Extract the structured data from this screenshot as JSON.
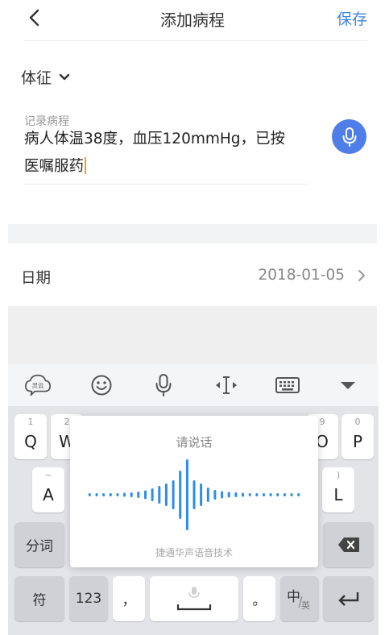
{
  "header": {
    "title": "添加病程",
    "save_label": "保存"
  },
  "category": {
    "selected": "体征"
  },
  "record": {
    "label": "记录病程",
    "text_line1": "病人体温38度，血压120mmHg，已按",
    "text_line2": "医嘱服药"
  },
  "date": {
    "label": "日期",
    "value": "2018-01-05"
  },
  "keyboard": {
    "toolbar": {
      "icons": [
        "cloud-logo-icon",
        "emoji-icon",
        "microphone-icon",
        "cursor-move-icon",
        "keyboard-icon",
        "collapse-arrow-icon"
      ],
      "cloud_logo_text": "灵云"
    },
    "row1": [
      {
        "main": "Q",
        "sub": "1"
      },
      {
        "main": "W",
        "sub": "2"
      },
      {
        "main": "O",
        "sub": "9"
      },
      {
        "main": "P",
        "sub": "0"
      }
    ],
    "row2": [
      {
        "main": "A",
        "sub": "~"
      },
      {
        "main": "L",
        "sub": ")"
      }
    ],
    "participle_label": "分词",
    "symbol_label": "符",
    "num_label": "123",
    "comma_label": "，",
    "period_label": "。",
    "lang_label": "中",
    "lang_sub": "英"
  },
  "voice_panel": {
    "hint": "请说话",
    "footer": "捷通华声语音技术",
    "wave_bar_levels": [
      0.04,
      0.04,
      0.04,
      0.04,
      0.04,
      0.05,
      0.06,
      0.08,
      0.11,
      0.16,
      0.22,
      0.28,
      0.36,
      0.6,
      0.88,
      0.36,
      0.28,
      0.18,
      0.12,
      0.09,
      0.07,
      0.06,
      0.05,
      0.04,
      0.04,
      0.04,
      0.04,
      0.04,
      0.04,
      0.04,
      0.04
    ],
    "wave_color": "#2e8de6"
  },
  "colors": {
    "accent": "#3d85e0",
    "mic_button": "#4f7ee8",
    "caret": "#f0a020"
  }
}
